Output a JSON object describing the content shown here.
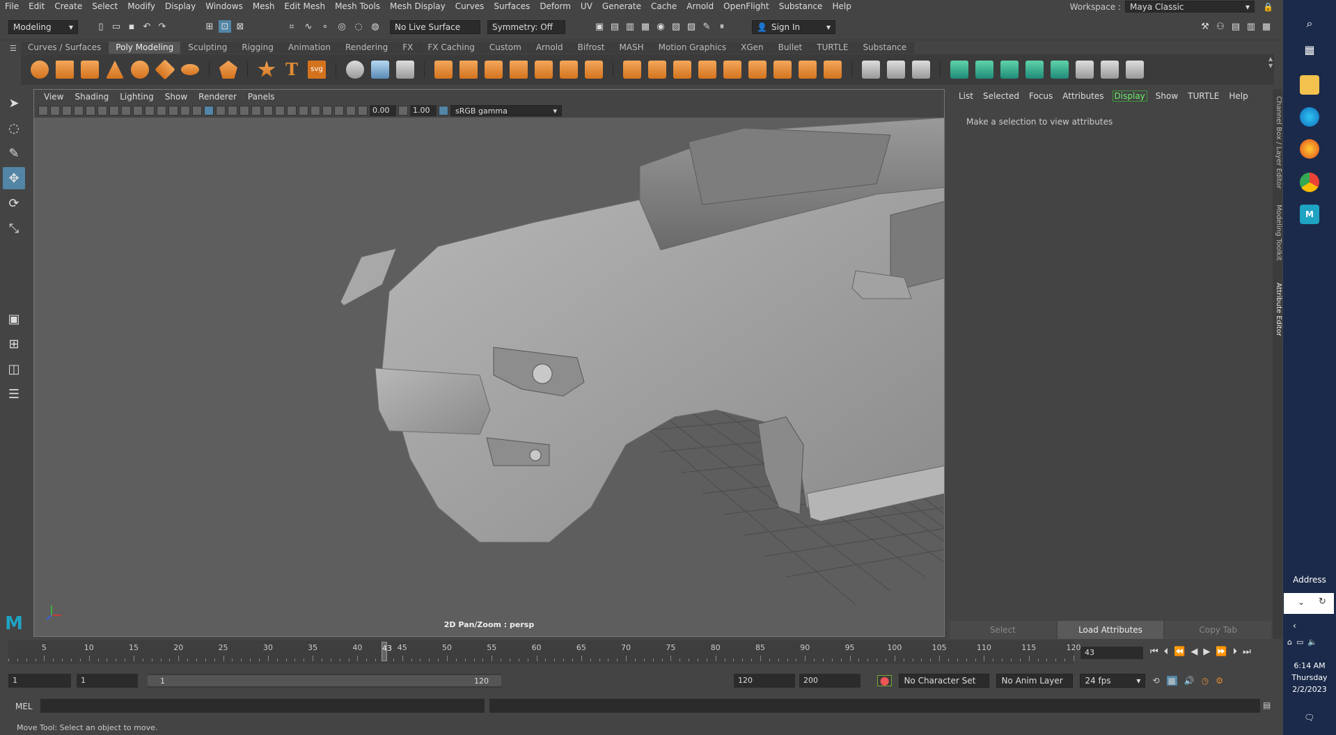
{
  "menubar": {
    "items": [
      "File",
      "Edit",
      "Create",
      "Select",
      "Modify",
      "Display",
      "Windows",
      "Mesh",
      "Edit Mesh",
      "Mesh Tools",
      "Mesh Display",
      "Curves",
      "Surfaces",
      "Deform",
      "UV",
      "Generate",
      "Cache",
      "Arnold",
      "OpenFlight",
      "Substance",
      "Help"
    ],
    "workspace_label": "Workspace :",
    "workspace_value": "Maya Classic"
  },
  "statusline": {
    "mode": "Modeling",
    "live_surface": "No Live Surface",
    "symmetry": "Symmetry: Off",
    "sign_in": "Sign In"
  },
  "shelf": {
    "tabs": [
      "Curves / Surfaces",
      "Poly Modeling",
      "Sculpting",
      "Rigging",
      "Animation",
      "Rendering",
      "FX",
      "FX Caching",
      "Custom",
      "Arnold",
      "Bifrost",
      "MASH",
      "Motion Graphics",
      "XGen",
      "Bullet",
      "TURTLE",
      "Substance"
    ],
    "active_tab": "Poly Modeling",
    "text_tool_label": "T",
    "svg_label": "svg"
  },
  "viewport": {
    "menu": [
      "View",
      "Shading",
      "Lighting",
      "Show",
      "Renderer",
      "Panels"
    ],
    "exposure": "0.00",
    "gamma": "1.00",
    "color_space": "sRGB gamma",
    "caption": "2D Pan/Zoom : persp"
  },
  "attribute_editor": {
    "menu": [
      "List",
      "Selected",
      "Focus",
      "Attributes",
      "Display",
      "Show",
      "TURTLE",
      "Help"
    ],
    "active_menu": "Display",
    "message": "Make a selection to view attributes",
    "buttons": [
      "Select",
      "Load Attributes",
      "Copy Tab"
    ]
  },
  "side_tabs": [
    "Channel Box / Layer Editor",
    "Modeling Toolkit",
    "Attribute Editor"
  ],
  "timeslider": {
    "ticks": [
      5,
      10,
      15,
      20,
      25,
      30,
      35,
      40,
      45,
      50,
      55,
      60,
      65,
      70,
      75,
      80,
      85,
      90,
      95,
      100,
      105,
      110,
      115,
      120
    ],
    "range_start": 1,
    "range_end": 120,
    "current_frame": "43"
  },
  "rangebar": {
    "start_frame": "1",
    "playback_start": "1",
    "slider_min": "1",
    "slider_max": "120",
    "playback_end": "120",
    "end_frame": "200",
    "character_set": "No Character Set",
    "anim_layer": "No Anim Layer",
    "fps": "24 fps"
  },
  "cmdline": {
    "label": "MEL"
  },
  "helpline": {
    "text": "Move Tool: Select an object to move."
  },
  "taskbar": {
    "address_label": "Address",
    "time": "6:14 AM",
    "day": "Thursday",
    "date": "2/2/2023"
  },
  "colors": {
    "accent_blue": "#5285a6",
    "display_green": "#6cf06c",
    "shelf_orange": "#e38b35",
    "viewport_bg": "#5e5e5e"
  }
}
